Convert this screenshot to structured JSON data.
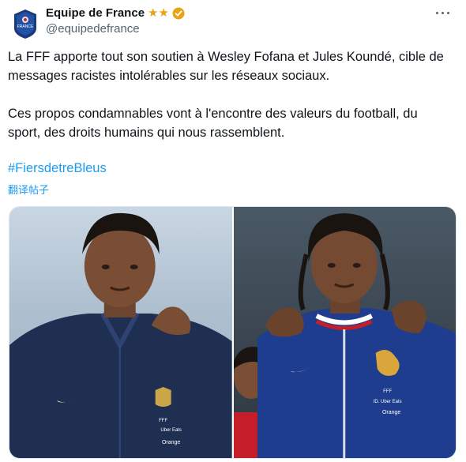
{
  "account": {
    "name": "Equipe de France",
    "handle": "@equipedefrance",
    "star_badges": "★★",
    "avatar_text": "FRANCE"
  },
  "post": {
    "paragraph1": "La FFF apporte tout son soutien à Wesley Fofana et Jules Koundé, cible de messages racistes intolérables sur les réseaux sociaux.",
    "paragraph2": "Ces propos condamnables vont à l'encontre des valeurs du football, du sport, des droits humains qui nous rassemblent.",
    "hashtag": "#FiersdetreBleus",
    "translate_label": "翻译帖子"
  },
  "media": {
    "left_shirt_text": [
      "FFF",
      "Uber Eats",
      "Orange"
    ],
    "right_shirt_text": [
      "FFF",
      "ID. Uber Eats",
      "Orange"
    ]
  },
  "colors": {
    "link": "#1d9bf0",
    "text": "#0f1419",
    "muted": "#536471",
    "verified": "#e8a317",
    "jersey": "#1e2f52"
  },
  "icons": [
    "fff-crest-icon",
    "verified-badge-icon",
    "more-options-icon"
  ]
}
